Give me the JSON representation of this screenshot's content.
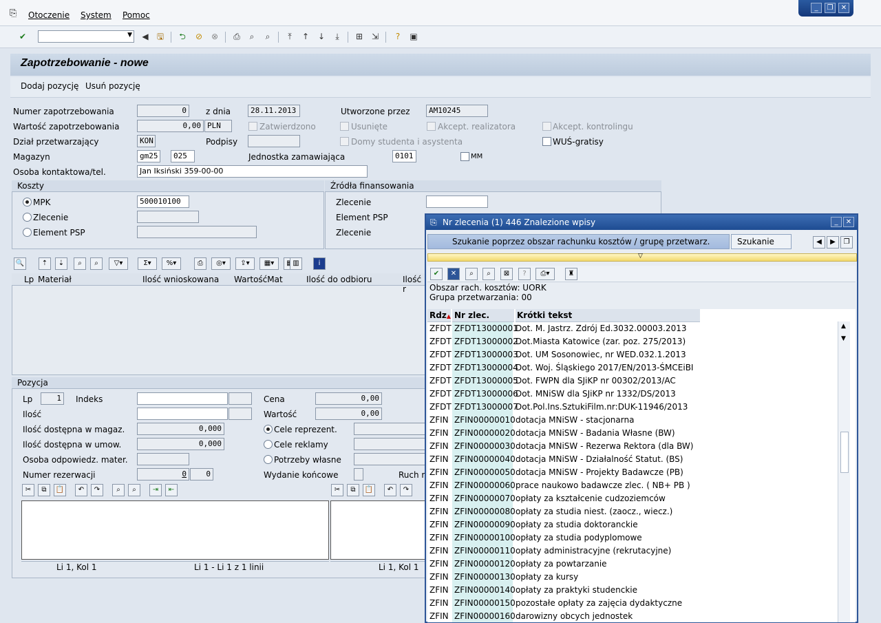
{
  "menu": {
    "items": [
      "Otoczenie",
      "System",
      "Pomoc"
    ]
  },
  "title": "Zapotrzebowanie - nowe",
  "appbar": {
    "add": "Dodaj pozycję",
    "remove": "Usuń pozycję"
  },
  "header": {
    "numer_label": "Numer zapotrzebowania",
    "numer_value": "0",
    "zdnia_label": "z dnia",
    "zdnia_value": "28.11.2013",
    "utworzone_label": "Utworzone przez",
    "utworzone_value": "AM10245",
    "wartosc_label": "Wartość zapotrzebowania",
    "wartosc_value": "0,00",
    "waluta": "PLN",
    "zatwierdzono": "Zatwierdzono",
    "usuniete": "Usunięte",
    "akcept_realizatora": "Akcept. realizatora",
    "akcept_kontrolingu": "Akcept. kontrolingu",
    "dzial_label": "Dział przetwarzający",
    "dzial_value": "KON",
    "podpisy_label": "Podpisy",
    "domy": "Domy studenta i asystenta",
    "wus": "WUŚ-gratisy",
    "magazyn_label": "Magazyn",
    "magazyn_value": "gm25",
    "magazyn_value2": "025",
    "jednostka_label": "Jednostka zamawiająca",
    "jednostka_value": "0101",
    "mm": "MM",
    "osoba_label": "Osoba kontaktowa/tel.",
    "osoba_value": "Jan Iksiński 359-00-00"
  },
  "koszty": {
    "title": "Koszty",
    "mpk": "MPK",
    "mpk_value": "500010100",
    "zlecenie": "Zlecenie",
    "element": "Element PSP"
  },
  "zrodla": {
    "title": "Źródła finansowania",
    "zlecenie": "Zlecenie",
    "element": "Element PSP",
    "zlecenie2": "Zlecenie"
  },
  "grid": {
    "cols": [
      "Lp",
      "Materiał",
      "Ilość wnioskowana",
      "WartośćMat",
      "Ilość do odbioru",
      "Ilość r"
    ]
  },
  "pozycja": {
    "title": "Pozycja",
    "lp_label": "Lp",
    "lp_value": "1",
    "indeks_label": "Indeks",
    "cena_label": "Cena",
    "cena_value": "0,00",
    "ilosc_label": "Ilość",
    "wartosc_label": "Wartość",
    "wartosc_value": "0,00",
    "dost_magaz_label": "Ilość dostępna w magaz.",
    "dost_magaz_value": "0,000",
    "cele_rep": "Cele reprezent.",
    "dost_umow_label": "Ilość dostępna w umow.",
    "dost_umow_value": "0,000",
    "cele_rek": "Cele reklamy",
    "osoba_label": "Osoba odpowiedz. mater.",
    "potrzeby": "Potrzeby własne",
    "rezerwacja_label": "Numer rezerwacji",
    "rezerwacja_value": "0",
    "rezerwacja_value2": "0",
    "wydanie": "Wydanie końcowe",
    "ruch": "Ruch m"
  },
  "status": {
    "left_pos": "Li 1, Kol 1",
    "left_lines": "Li 1 - Li 1 z 1 linii",
    "right_pos": "Li 1, Kol 1"
  },
  "dialog": {
    "title": "Nr zlecenia (1)  446 Znalezione wpisy",
    "tab1": "Szukanie poprzez obszar rachunku kosztów / grupę  przetwarz.",
    "tab2": "Szukanie po...",
    "info1": "Obszar rach. kosztów: UORK",
    "info2": "Grupa przetwarzania: 00",
    "cols": [
      "Rdz",
      "Nr zlec.",
      "Krótki tekst"
    ],
    "rows": [
      [
        "ZFDT",
        "ZFDT13000001",
        "Dot. M. Jastrz. Zdrój Ed.3032.00003.2013"
      ],
      [
        "ZFDT",
        "ZFDT13000002",
        "Dot.Miasta Katowice (zar. poz. 275/2013)"
      ],
      [
        "ZFDT",
        "ZFDT13000003",
        "Dot. UM Sosonowiec, nr WED.032.1.2013"
      ],
      [
        "ZFDT",
        "ZFDT13000004",
        "Dot. Woj. Śląskiego 2017/EN/2013-ŚMCEiBI"
      ],
      [
        "ZFDT",
        "ZFDT13000005",
        "Dot. FWPN dla SJiKP nr 00302/2013/AC"
      ],
      [
        "ZFDT",
        "ZFDT13000006",
        "Dot. MNiSW dla SJiKP nr 1332/DS/2013"
      ],
      [
        "ZFDT",
        "ZFDT13000007",
        "Dot.Pol.Ins.SztukiFilm.nr:DUK-11946/2013"
      ],
      [
        "ZFIN",
        "ZFIN00000010",
        "dotacja MNiSW - stacjonarna"
      ],
      [
        "ZFIN",
        "ZFIN00000020",
        "dotacja MNiSW - Badania Własne (BW)"
      ],
      [
        "ZFIN",
        "ZFIN00000030",
        "dotacja MNiSW - Rezerwa Rektora (dla BW)"
      ],
      [
        "ZFIN",
        "ZFIN00000040",
        "dotacja MNiSW - Działalność Statut. (BS)"
      ],
      [
        "ZFIN",
        "ZFIN00000050",
        "dotacja MNiSW - Projekty Badawcze (PB)"
      ],
      [
        "ZFIN",
        "ZFIN00000060",
        "prace naukowo badawcze zlec. ( NB+ PB )"
      ],
      [
        "ZFIN",
        "ZFIN00000070",
        "opłaty za kształcenie cudzoziemców"
      ],
      [
        "ZFIN",
        "ZFIN00000080",
        "opłaty za studia niest. (zaocz., wiecz.)"
      ],
      [
        "ZFIN",
        "ZFIN00000090",
        "opłaty za studia doktoranckie"
      ],
      [
        "ZFIN",
        "ZFIN00000100",
        "opłaty za studia podyplomowe"
      ],
      [
        "ZFIN",
        "ZFIN00000110",
        "opłaty administracyjne (rekrutacyjne)"
      ],
      [
        "ZFIN",
        "ZFIN00000120",
        "opłaty za powtarzanie"
      ],
      [
        "ZFIN",
        "ZFIN00000130",
        "opłaty za kursy"
      ],
      [
        "ZFIN",
        "ZFIN00000140",
        "opłaty za praktyki studenckie"
      ],
      [
        "ZFIN",
        "ZFIN00000150",
        "pozostałe opłaty za zajęcia dydaktyczne"
      ],
      [
        "ZFIN",
        "ZFIN00000160",
        "darowizny obcych jednostek"
      ]
    ]
  }
}
